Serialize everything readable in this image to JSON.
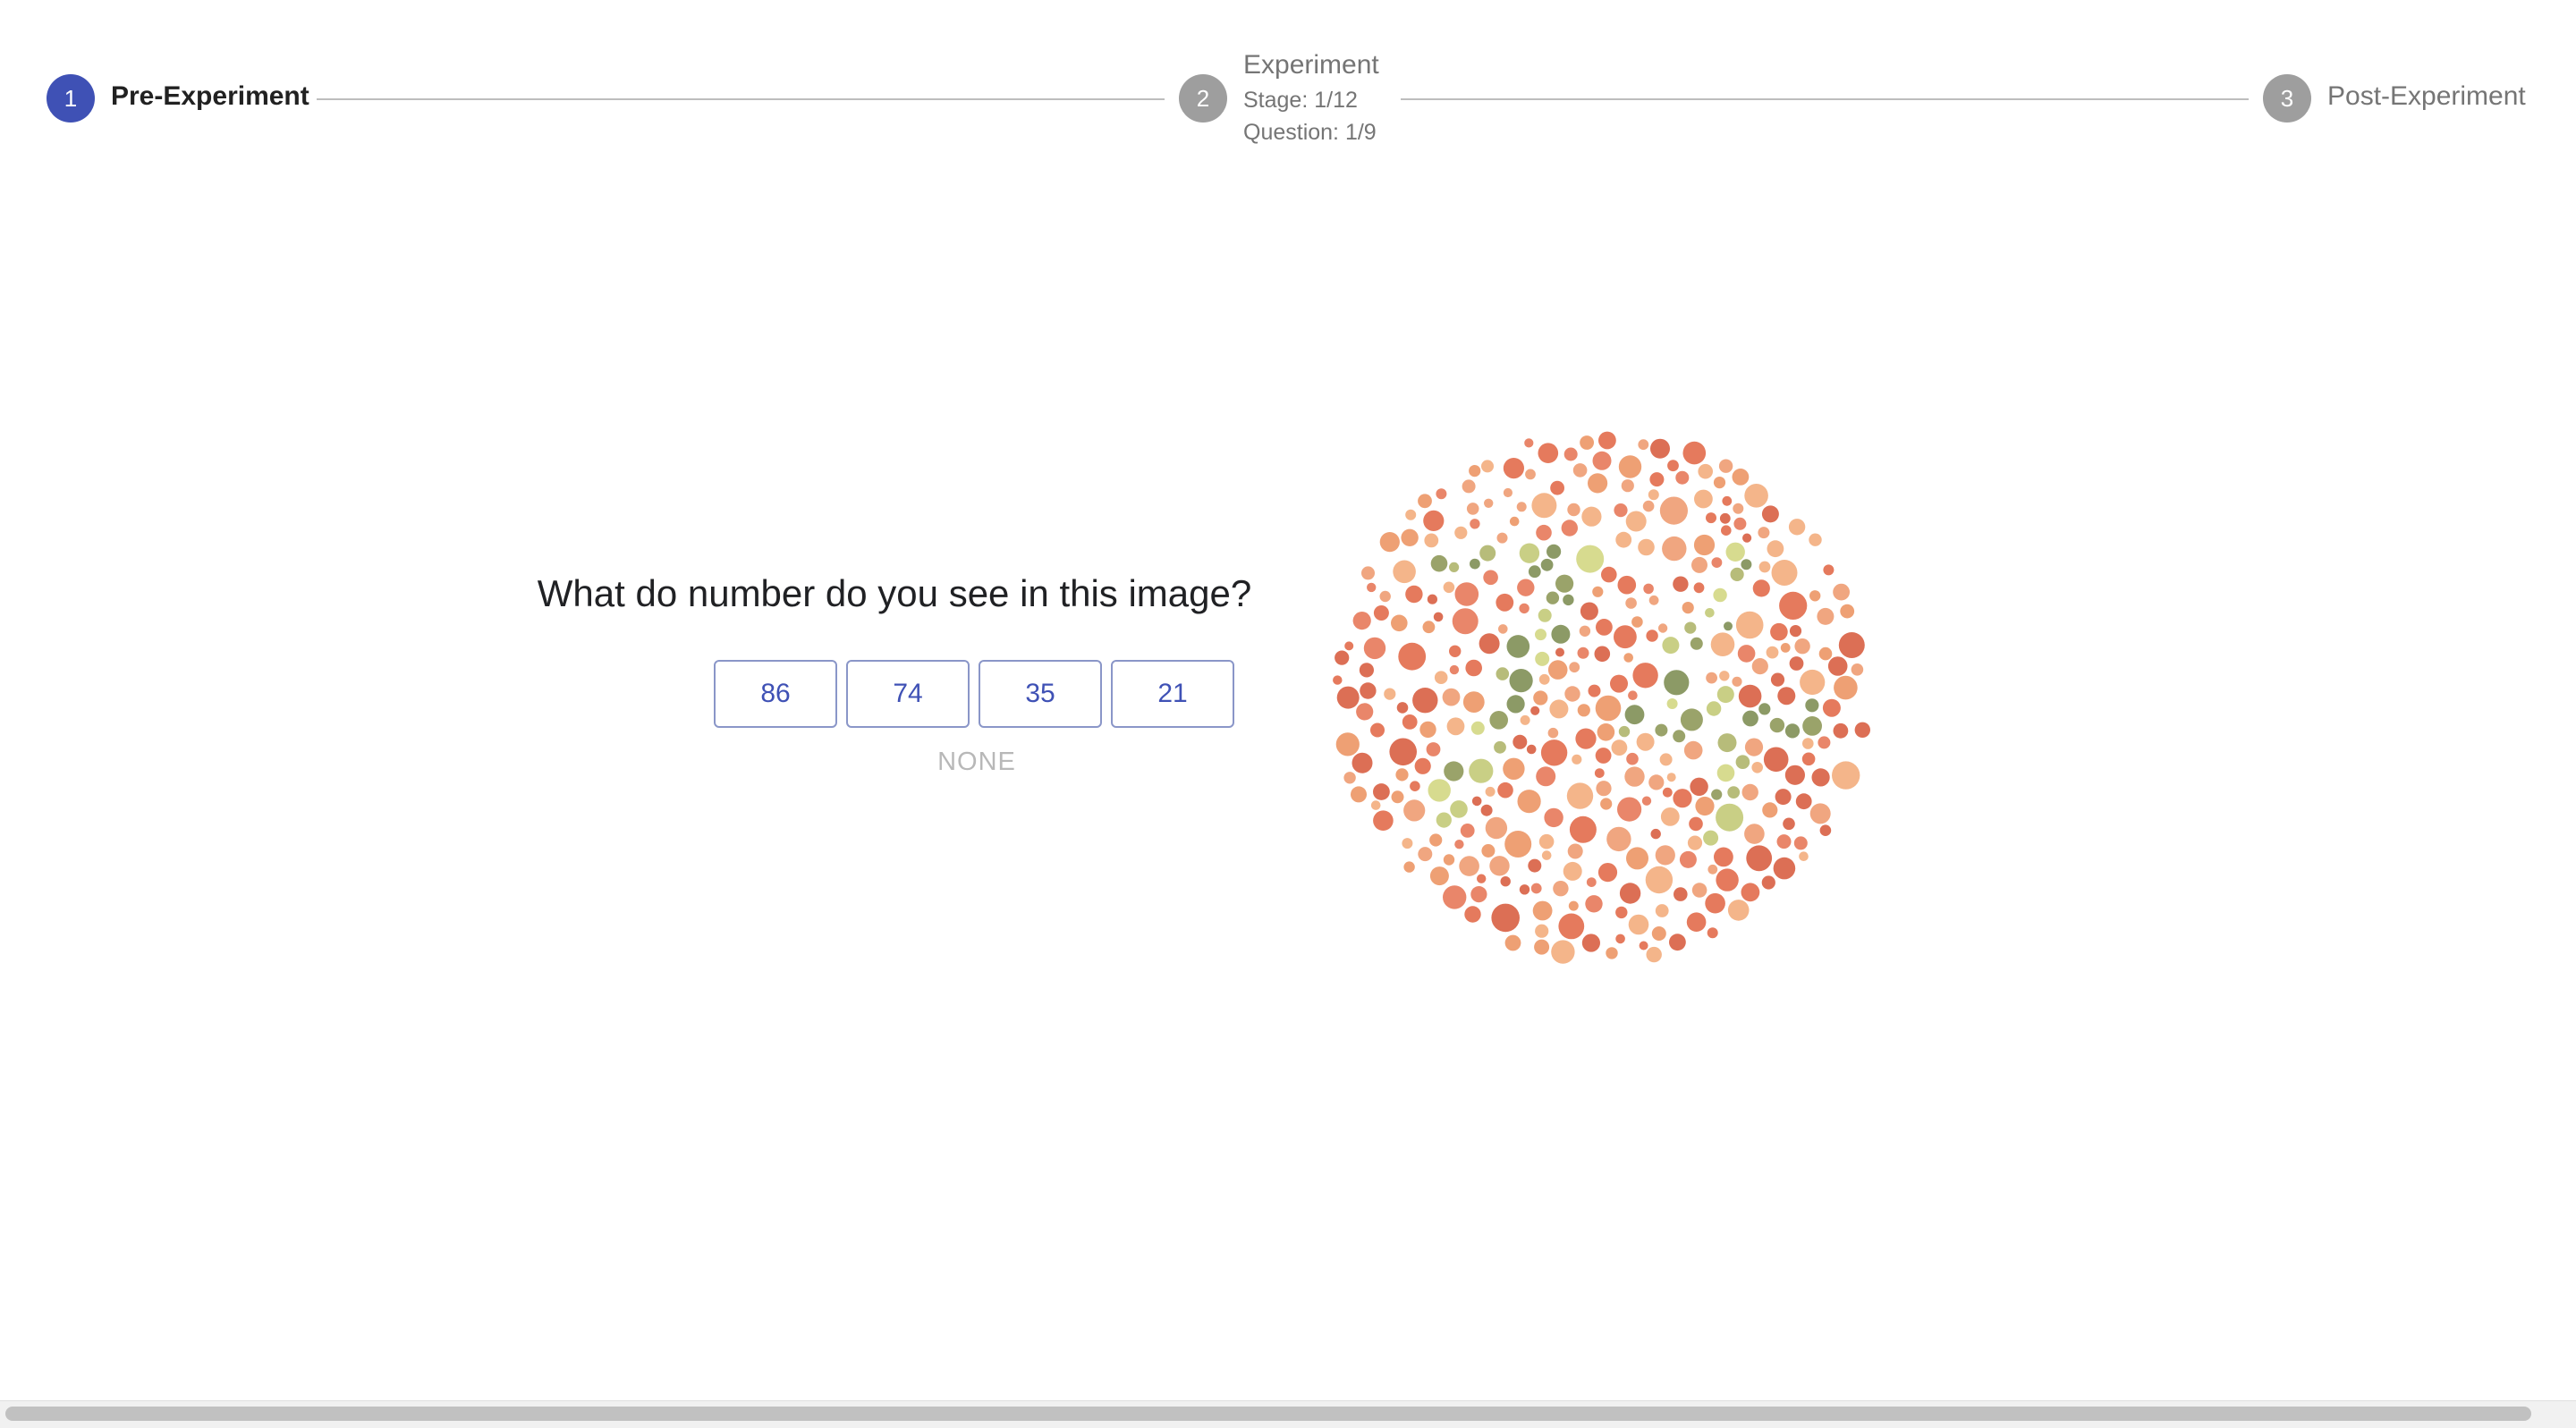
{
  "stepper": {
    "steps": [
      {
        "number": "1",
        "label": "Pre-Experiment",
        "state": "active"
      },
      {
        "number": "2",
        "label": "Experiment",
        "stage": "Stage: 1/12",
        "question": "Question: 1/9",
        "state": "inactive"
      },
      {
        "number": "3",
        "label": "Post-Experiment",
        "state": "inactive"
      }
    ]
  },
  "main": {
    "question": "What do number do you see in this image?",
    "answers": [
      "86",
      "74",
      "35",
      "21"
    ],
    "none_label": "NONE",
    "image_icon": "ishihara-color-plate"
  },
  "colors": {
    "accent": "#3f51b5",
    "inactive_step": "#9e9e9e",
    "dot_background": [
      "#e9866a",
      "#f0a680",
      "#dc6f55",
      "#f4b58a",
      "#e57a5d",
      "#eea074"
    ],
    "dot_figure": [
      "#9aa36a",
      "#b7bc7a",
      "#c9cf85",
      "#8c9a66",
      "#d7db8f"
    ]
  }
}
